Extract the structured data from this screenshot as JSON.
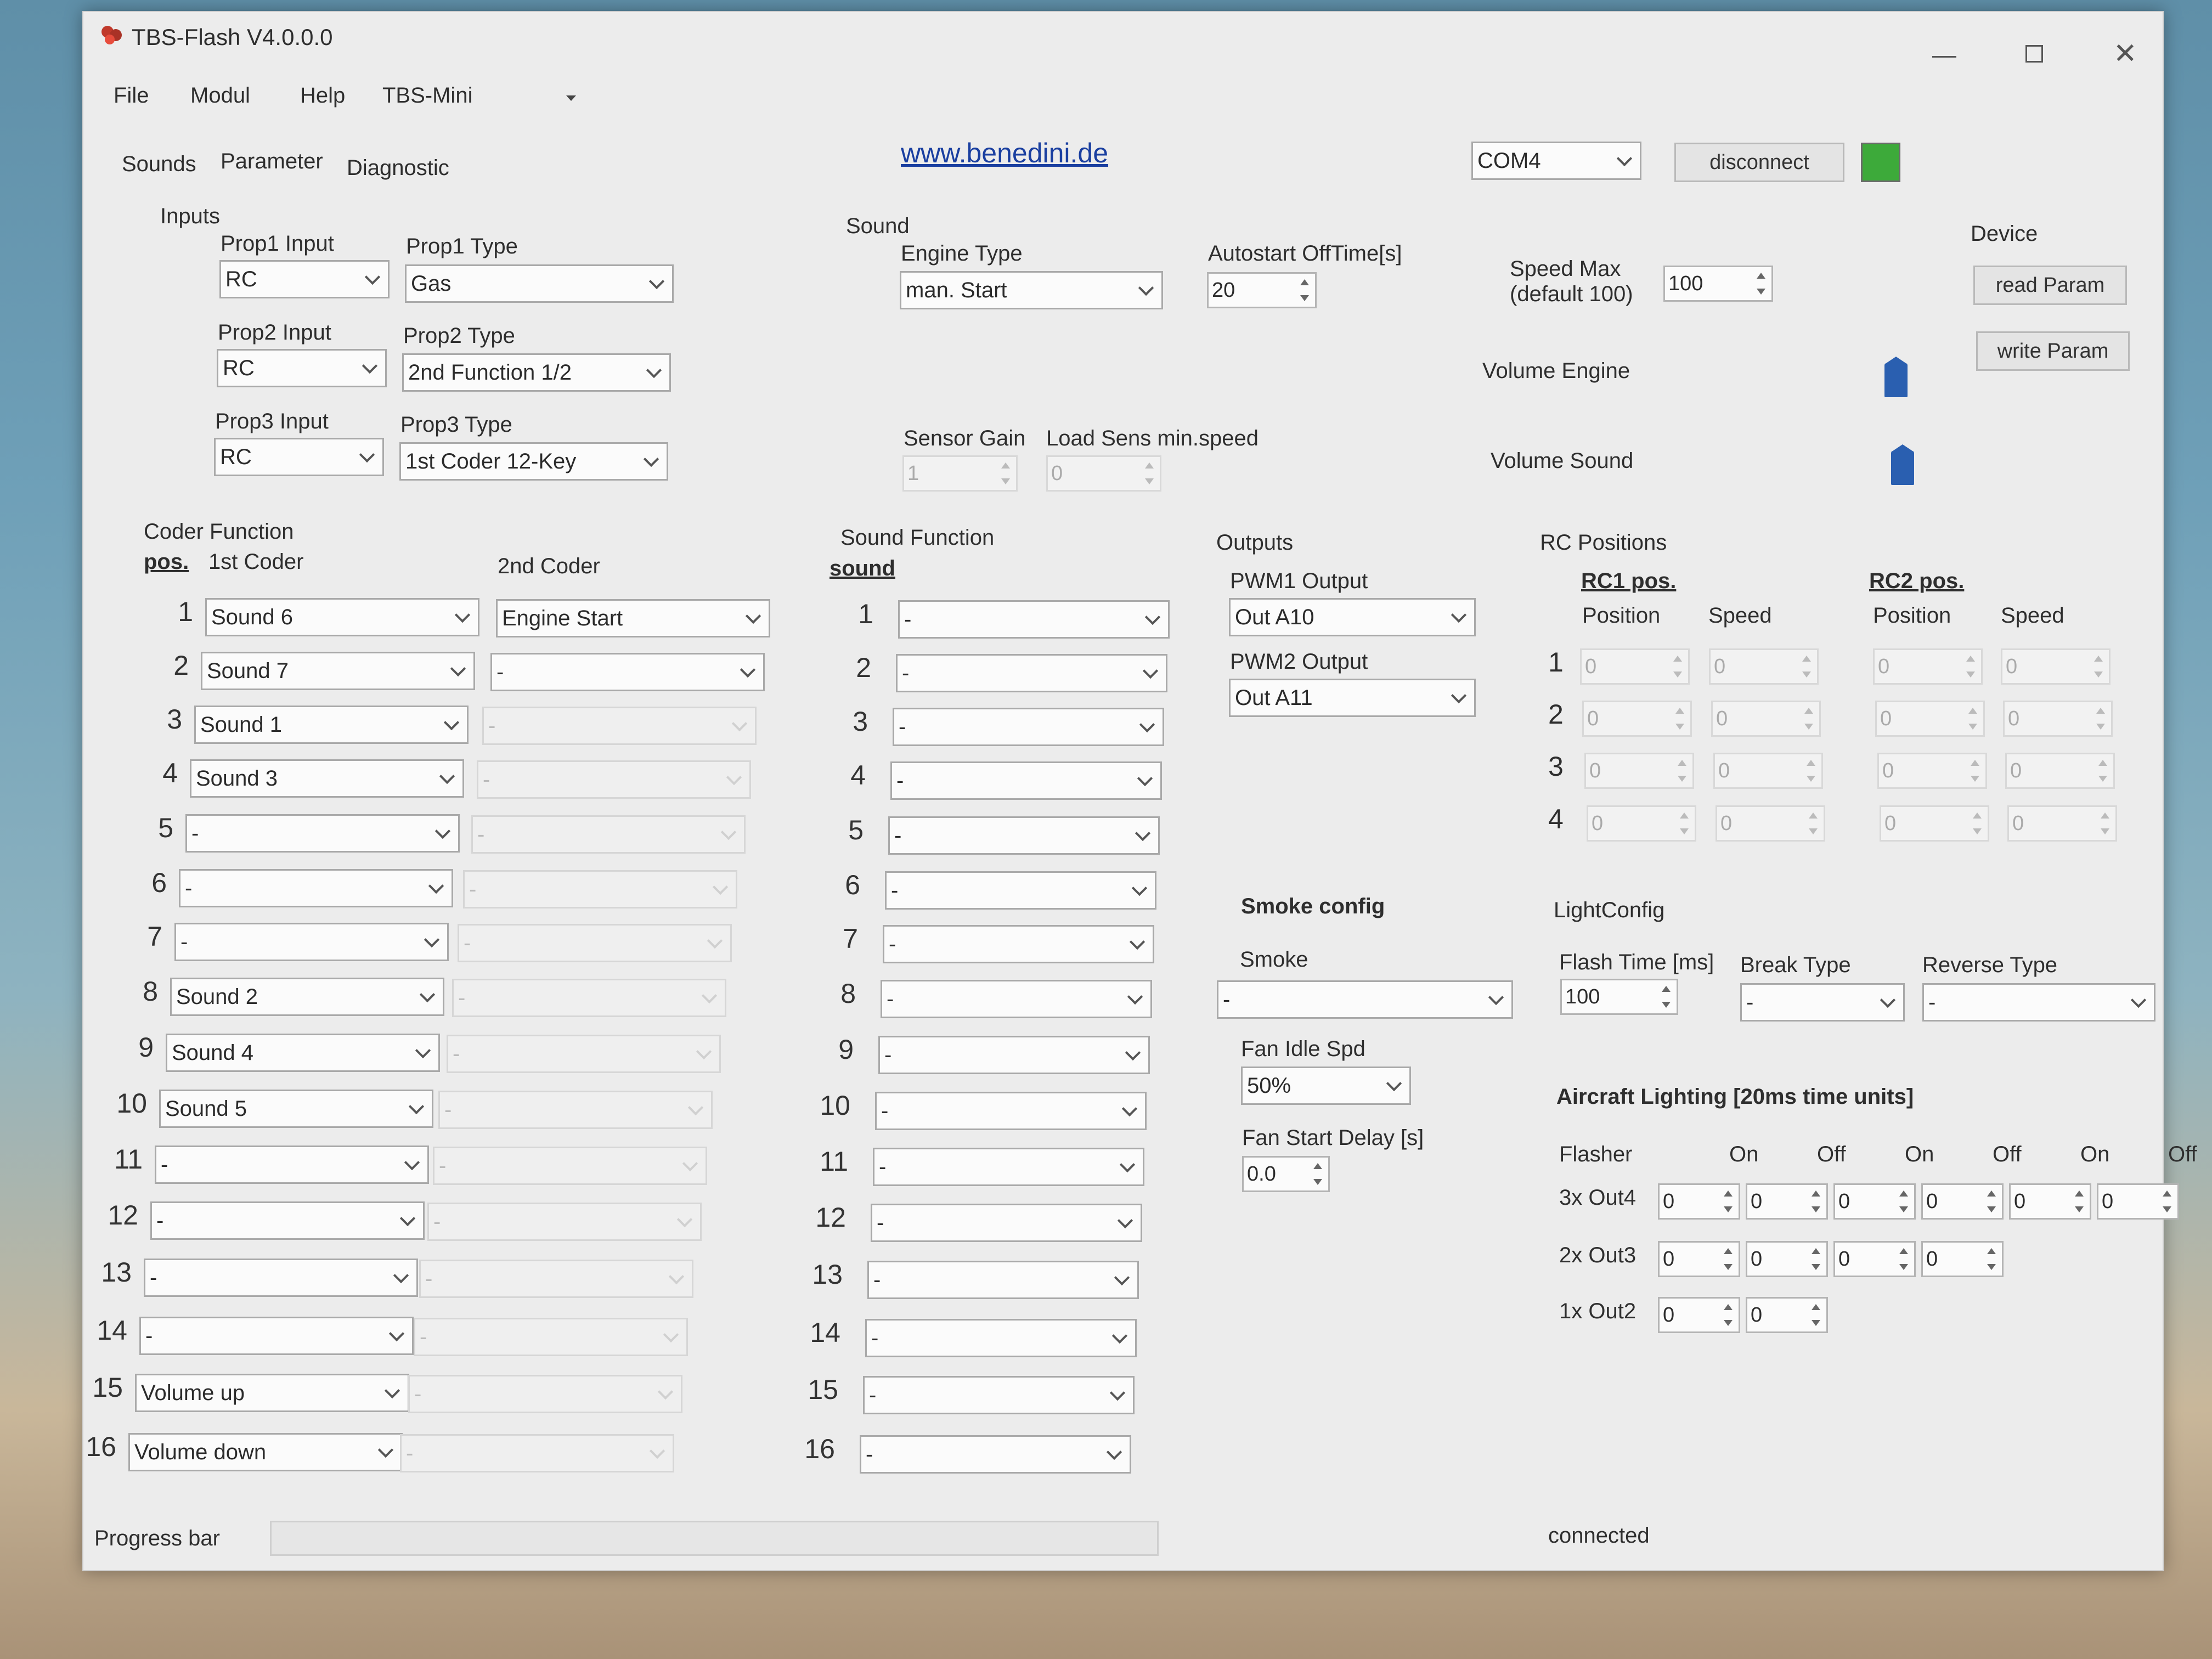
{
  "window": {
    "title": "TBS-Flash V4.0.0.0"
  },
  "menu": [
    "File",
    "Modul",
    "Help",
    "TBS-Mini"
  ],
  "tabs": [
    "Sounds",
    "Parameter",
    "Diagnostic"
  ],
  "link": "www.benedini.de",
  "com": {
    "port": "COM4",
    "disconnect": "disconnect",
    "status_color": "#3daa3a"
  },
  "inputs": {
    "label": "Inputs",
    "props": [
      {
        "input_label": "Prop1 Input",
        "input_value": "RC",
        "type_label": "Prop1 Type",
        "type_value": "Gas"
      },
      {
        "input_label": "Prop2 Input",
        "input_value": "RC",
        "type_label": "Prop2 Type",
        "type_value": "2nd Function 1/2"
      },
      {
        "input_label": "Prop3 Input",
        "input_value": "RC",
        "type_label": "Prop3 Type",
        "type_value": "1st Coder 12-Key"
      }
    ]
  },
  "sound": {
    "label": "Sound",
    "engine_type_label": "Engine Type",
    "engine_type": "man. Start",
    "autostart_label": "Autostart OffTime[s]",
    "autostart": "20",
    "speed_max_label1": "Speed Max",
    "speed_max_label2": "(default 100)",
    "speed_max": "100",
    "sensor_gain_label": "Sensor Gain",
    "sensor_gain": "1",
    "load_sens_label": "Load Sens min.speed",
    "load_sens": "0",
    "volume_engine_label": "Volume Engine",
    "volume_sound_label": "Volume Sound"
  },
  "device": {
    "label": "Device",
    "read": "read Param",
    "write": "write Param"
  },
  "coder": {
    "label": "Coder Function",
    "pos_label": "pos.",
    "first_label": "1st Coder",
    "second_label": "2nd Coder",
    "rows": [
      {
        "pos": "1",
        "first": "Sound 6",
        "second": "Engine Start",
        "second_enabled": true
      },
      {
        "pos": "2",
        "first": "Sound 7",
        "second": "-",
        "second_enabled": true
      },
      {
        "pos": "3",
        "first": "Sound 1",
        "second": "-",
        "second_enabled": false
      },
      {
        "pos": "4",
        "first": "Sound 3",
        "second": "-",
        "second_enabled": false
      },
      {
        "pos": "5",
        "first": "-",
        "second": "-",
        "second_enabled": false
      },
      {
        "pos": "6",
        "first": "-",
        "second": "-",
        "second_enabled": false
      },
      {
        "pos": "7",
        "first": "-",
        "second": "-",
        "second_enabled": false
      },
      {
        "pos": "8",
        "first": "Sound 2",
        "second": "-",
        "second_enabled": false
      },
      {
        "pos": "9",
        "first": "Sound 4",
        "second": "-",
        "second_enabled": false
      },
      {
        "pos": "10",
        "first": "Sound 5",
        "second": "-",
        "second_enabled": false
      },
      {
        "pos": "11",
        "first": "-",
        "second": "-",
        "second_enabled": false
      },
      {
        "pos": "12",
        "first": "-",
        "second": "-",
        "second_enabled": false
      },
      {
        "pos": "13",
        "first": "-",
        "second": "-",
        "second_enabled": false
      },
      {
        "pos": "14",
        "first": "-",
        "second": "-",
        "second_enabled": false
      },
      {
        "pos": "15",
        "first": "Volume up",
        "second": "-",
        "second_enabled": false
      },
      {
        "pos": "16",
        "first": "Volume down",
        "second": "-",
        "second_enabled": false
      }
    ]
  },
  "sound_function": {
    "label": "Sound Function",
    "col_label": "sound",
    "rows": [
      "-",
      "-",
      "-",
      "-",
      "-",
      "-",
      "-",
      "-",
      "-",
      "-",
      "-",
      "-",
      "-",
      "-",
      "-",
      "-"
    ]
  },
  "outputs": {
    "label": "Outputs",
    "pwm1_label": "PWM1 Output",
    "pwm1": "Out A10",
    "pwm2_label": "PWM2 Output",
    "pwm2": "Out A11"
  },
  "rc_positions": {
    "label": "RC Positions",
    "rc1": "RC1 pos.",
    "rc2": "RC2 pos.",
    "position": "Position",
    "speed": "Speed",
    "rows": [
      {
        "n": "1",
        "rc1_pos": "0",
        "rc1_speed": "0",
        "rc2_pos": "0",
        "rc2_speed": "0"
      },
      {
        "n": "2",
        "rc1_pos": "0",
        "rc1_speed": "0",
        "rc2_pos": "0",
        "rc2_speed": "0"
      },
      {
        "n": "3",
        "rc1_pos": "0",
        "rc1_speed": "0",
        "rc2_pos": "0",
        "rc2_speed": "0"
      },
      {
        "n": "4",
        "rc1_pos": "0",
        "rc1_speed": "0",
        "rc2_pos": "0",
        "rc2_speed": "0"
      }
    ]
  },
  "smoke": {
    "label": "Smoke config",
    "smoke_label": "Smoke",
    "smoke": "-",
    "fan_idle_label": "Fan Idle Spd",
    "fan_idle": "50%",
    "fan_delay_label": "Fan Start Delay [s]",
    "fan_delay": "0.0"
  },
  "light": {
    "label": "LightConfig",
    "flash_label": "Flash Time [ms]",
    "flash": "100",
    "break_label": "Break Type",
    "break": "-",
    "reverse_label": "Reverse Type",
    "reverse": "-"
  },
  "aircraft": {
    "label": "Aircraft Lighting [20ms time units]",
    "flasher": "Flasher",
    "headers": [
      "On",
      "Off",
      "On",
      "Off",
      "On",
      "Off"
    ],
    "rows": [
      {
        "label": "3x Out4",
        "values": [
          "0",
          "0",
          "0",
          "0",
          "0",
          "0"
        ]
      },
      {
        "label": "2x Out3",
        "values": [
          "0",
          "0",
          "0",
          "0"
        ]
      },
      {
        "label": "1x Out2",
        "values": [
          "0",
          "0"
        ]
      }
    ]
  },
  "footer": {
    "progress_label": "Progress bar",
    "progress": 0,
    "status": "connected"
  }
}
